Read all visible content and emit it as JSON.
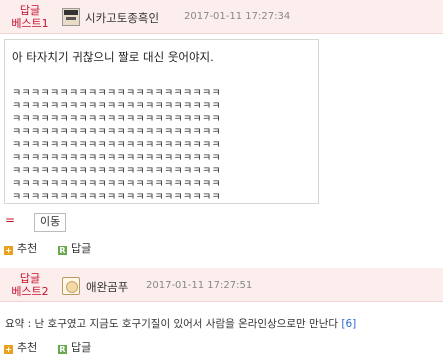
{
  "comment1": {
    "best_label_line1": "답글",
    "best_label_line2": "베스트1",
    "nickname": "시카고토종흑인",
    "date": "2017-01-11 17:27:34",
    "text_line1": "아 타자치기 귀찮으니 짤로 대신 웃어야지.",
    "laugh_lines": [
      "ㅋㅋㅋㅋㅋㅋㅋㅋㅋㅋㅋㅋㅋㅋㅋㅋㅋㅋㅋㅋㅋㅋ",
      "ㅋㅋㅋㅋㅋㅋㅋㅋㅋㅋㅋㅋㅋㅋㅋㅋㅋㅋㅋㅋㅋㅋ",
      "ㅋㅋㅋㅋㅋㅋㅋㅋㅋㅋㅋㅋㅋㅋㅋㅋㅋㅋㅋㅋㅋㅋ",
      "ㅋㅋㅋㅋㅋㅋㅋㅋㅋㅋㅋㅋㅋㅋㅋㅋㅋㅋㅋㅋㅋㅋ",
      "ㅋㅋㅋㅋㅋㅋㅋㅋㅋㅋㅋㅋㅋㅋㅋㅋㅋㅋㅋㅋㅋㅋ",
      "ㅋㅋㅋㅋㅋㅋㅋㅋㅋㅋㅋㅋㅋㅋㅋㅋㅋㅋㅋㅋㅋㅋ",
      "ㅋㅋㅋㅋㅋㅋㅋㅋㅋㅋㅋㅋㅋㅋㅋㅋㅋㅋㅋㅋㅋㅋ",
      "ㅋㅋㅋㅋㅋㅋㅋㅋㅋㅋㅋㅋㅋㅋㅋㅋㅋㅋㅋㅋㅋㅋ",
      "ㅋㅋㅋㅋㅋㅋㅋㅋㅋㅋㅋㅋㅋㅋㅋㅋㅋㅋㅋㅋㅋㅋ"
    ],
    "eq_mark": "=",
    "tag_label": "이동",
    "recommend_label": "추천",
    "reply_label": "답글"
  },
  "comment2": {
    "best_label_line1": "답글",
    "best_label_line2": "베스트2",
    "nickname": "애완곰푸",
    "date": "2017-01-11 17:27:51",
    "summary_text": "요약 : 난 호구였고 지금도 호구기질이 있어서 사람을 온라인상으로만 만난다",
    "summary_count": "[6]",
    "recommend_label": "추천",
    "reply_label": "답글"
  },
  "icons": {
    "plus_icon_glyph": "+",
    "reply_icon_glyph": "R"
  },
  "colors": {
    "best_label": "#c8102e",
    "header_bg": "#fdeeee",
    "recommend_icon": "#e9a11e",
    "reply_icon": "#6aa84f",
    "count_link": "#2a6bd1"
  }
}
